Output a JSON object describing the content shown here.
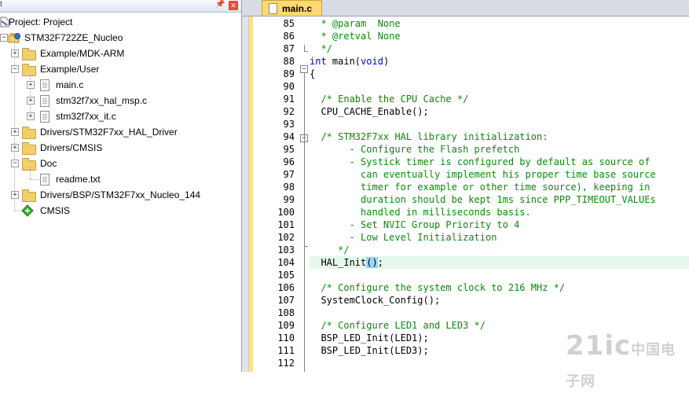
{
  "project_panel": {
    "header_edge": "t",
    "root_label": "Project: Project",
    "target": "STM32F722ZE_Nucleo",
    "groups": [
      {
        "label": "Example/MDK-ARM",
        "expanded": false
      },
      {
        "label": "Example/User",
        "expanded": true,
        "files": [
          "main.c",
          "stm32f7xx_hal_msp.c",
          "stm32f7xx_it.c"
        ]
      },
      {
        "label": "Drivers/STM32F7xx_HAL_Driver",
        "expanded": false
      },
      {
        "label": "Drivers/CMSIS",
        "expanded": false
      },
      {
        "label": "Doc",
        "expanded": true,
        "files": [
          "readme.txt"
        ]
      },
      {
        "label": "Drivers/BSP/STM32F7xx_Nucleo_144",
        "expanded": false
      }
    ],
    "cmsis_label": "CMSIS"
  },
  "editor": {
    "tab_label": "main.c",
    "lines": [
      {
        "n": "85",
        "text": "  * @param  None",
        "type": "comment"
      },
      {
        "n": "86",
        "text": "  * @retval None",
        "type": "comment"
      },
      {
        "n": "87",
        "text": "  */",
        "type": "comment"
      },
      {
        "n": "88",
        "text": "int main(void)",
        "type": "keyword"
      },
      {
        "n": "89",
        "text": "{",
        "type": "code"
      },
      {
        "n": "90",
        "text": "",
        "type": "code"
      },
      {
        "n": "91",
        "text": "  /* Enable the CPU Cache */",
        "type": "comment"
      },
      {
        "n": "92",
        "text": "  CPU_CACHE_Enable();",
        "type": "code"
      },
      {
        "n": "93",
        "text": "",
        "type": "code"
      },
      {
        "n": "94",
        "text": "  /* STM32F7xx HAL library initialization:",
        "type": "comment"
      },
      {
        "n": "95",
        "text": "       - Configure the Flash prefetch",
        "type": "comment"
      },
      {
        "n": "96",
        "text": "       - Systick timer is configured by default as source of",
        "type": "comment"
      },
      {
        "n": "97",
        "text": "         can eventually implement his proper time base source",
        "type": "comment"
      },
      {
        "n": "98",
        "text": "         timer for example or other time source), keeping in",
        "type": "comment"
      },
      {
        "n": "99",
        "text": "         duration should be kept 1ms since PPP_TIMEOUT_VALUEs",
        "type": "comment"
      },
      {
        "n": "100",
        "text": "         handled in milliseconds basis.",
        "type": "comment"
      },
      {
        "n": "101",
        "text": "       - Set NVIC Group Priority to 4",
        "type": "comment"
      },
      {
        "n": "102",
        "text": "       - Low Level Initialization",
        "type": "comment"
      },
      {
        "n": "103",
        "text": "     */",
        "type": "comment"
      },
      {
        "n": "104",
        "text": "  HAL_Init();",
        "type": "current"
      },
      {
        "n": "105",
        "text": "",
        "type": "code"
      },
      {
        "n": "106",
        "text": "  /* Configure the system clock to 216 MHz */",
        "type": "comment"
      },
      {
        "n": "107",
        "text": "  SystemClock_Config();",
        "type": "code"
      },
      {
        "n": "108",
        "text": "",
        "type": "code"
      },
      {
        "n": "109",
        "text": "  /* Configure LED1 and LED3 */",
        "type": "comment"
      },
      {
        "n": "110",
        "text": "  BSP_LED_Init(LED1);",
        "type": "code"
      },
      {
        "n": "111",
        "text": "  BSP_LED_Init(LED3);",
        "type": "code"
      },
      {
        "n": "112",
        "text": "",
        "type": "code"
      }
    ],
    "current_line": {
      "prefix": "  HAL_Init",
      "bracket": "()",
      "suffix": ";"
    },
    "keyword_line": {
      "kw": "int",
      "rest1": " main(",
      "kw2": "void",
      "rest2": ")"
    }
  },
  "watermark": {
    "main": "21ic",
    "sub": "中国电子网"
  },
  "colors": {
    "comment": "#0a8a0a",
    "keyword": "#0000e6",
    "current_line_bg": "#e6f8ec",
    "tab_bg": "#ffd870",
    "folder": "#f1cf6a",
    "bracket_highlight": "#9ad7f5"
  },
  "icons": [
    "pin-icon",
    "close-icon",
    "project-icon",
    "target-icon",
    "folder-icon",
    "file-icon",
    "cmsis-diamond-icon",
    "fold-minus-icon",
    "tree-expand-icon"
  ]
}
